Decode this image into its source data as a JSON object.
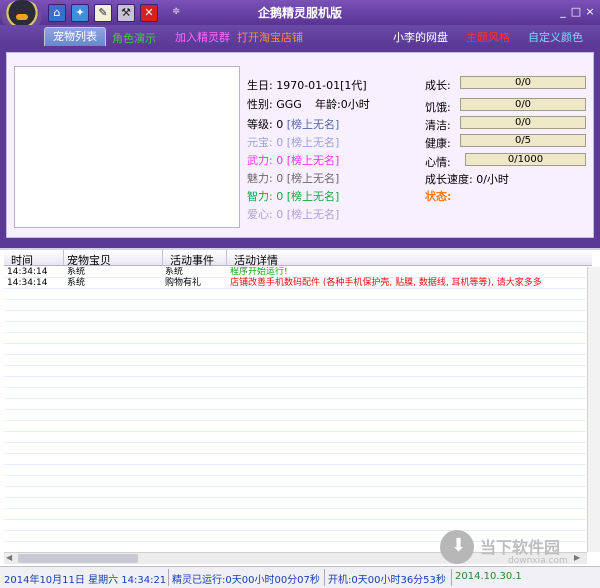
{
  "window": {
    "title": "企鹅精灵服机版",
    "toolbar_icons": [
      "home-icon",
      "settings-icon",
      "notepad-icon",
      "tools-icon",
      "close-red-icon"
    ],
    "min_glyph": "_",
    "max_glyph": "□",
    "close_glyph": "×",
    "menu_glyph": "≑"
  },
  "tabs": {
    "active": "宠物列表",
    "inactive": "角色演示",
    "join_group": "加入精灵群",
    "open_shop": "打开淘宝店铺",
    "my_disk": "小李的网盘",
    "theme": "主题风格",
    "custom_color": "自定义颜色"
  },
  "pet": {
    "birthday_label": "生日:",
    "birthday": "1970-01-01[1代]",
    "gender_label": "性别:",
    "gender": "GGG",
    "age": "年龄:0小时",
    "level_label": "等级:",
    "level_value": "0",
    "yuanbao_label": "元宝:",
    "yuanbao_value": "0",
    "force_label": "武力:",
    "force_value": "0",
    "charm_label": "魅力:",
    "charm_value": "0",
    "intel_label": "智力:",
    "intel_value": "0",
    "love_label": "爱心:",
    "love_value": "0",
    "rank_text": "[榜上无名]"
  },
  "stats": {
    "growth_label": "成长:",
    "growth": "0/0",
    "hunger_label": "饥饿:",
    "hunger": "0/0",
    "clean_label": "清洁:",
    "clean": "0/0",
    "health_label": "健康:",
    "health": "0/5",
    "mood_label": "心情:",
    "mood": "0/1000",
    "speed_text": "成长速度: 0/小时",
    "status_label": "状态:"
  },
  "log": {
    "columns": [
      "时间",
      "宠物宝贝",
      "活动事件",
      "活动详情"
    ],
    "rows": [
      {
        "time": "14:34:14",
        "pet": "系统",
        "event": "系统",
        "detail": "程序开始运行!",
        "detail_color": "#11a011"
      },
      {
        "time": "14:34:14",
        "pet": "系统",
        "event": "购物有礼",
        "detail": "店铺改善手机数码配件 (各种手机保护壳, 贴膜, 数据线, 耳机等等), 请大家多多",
        "detail_color": "#e01010"
      }
    ]
  },
  "watermark": {
    "brand": "当下软件园",
    "domain": "downxia.com"
  },
  "statusbar": {
    "date": "2014年10月11日 星期六 14:34:21",
    "runtime": "精灵已运行:0天00小时00分07秒",
    "boot": "开机:0天00小时36分53秒",
    "version": "2014.10.30.1"
  }
}
